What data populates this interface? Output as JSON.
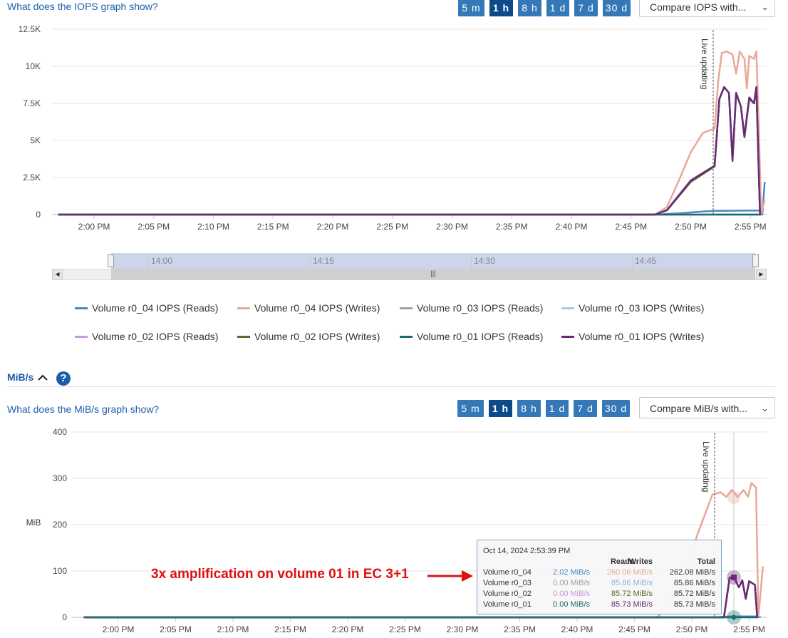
{
  "iops_section": {
    "help_link": "What does the IOPS graph show?",
    "range_buttons": [
      "5 m",
      "1 h",
      "8 h",
      "1 d",
      "7 d",
      "30 d"
    ],
    "active_range": "1 h",
    "compare_label": "Compare IOPS with...",
    "live_label": "Live updating",
    "navigator_ticks": [
      "14:00",
      "14:15",
      "14:30",
      "14:45"
    ],
    "legend": [
      {
        "name": "Volume r0_04 IOPS (Reads)",
        "color": "#4a88c0"
      },
      {
        "name": "Volume r0_04 IOPS (Writes)",
        "color": "#e8a898"
      },
      {
        "name": "Volume r0_03 IOPS (Reads)",
        "color": "#a0a0a0"
      },
      {
        "name": "Volume r0_03 IOPS (Writes)",
        "color": "#a8c8e8"
      },
      {
        "name": "Volume r0_02 IOPS (Reads)",
        "color": "#c89ad8"
      },
      {
        "name": "Volume r0_02 IOPS (Writes)",
        "color": "#556b2f"
      },
      {
        "name": "Volume r0_01 IOPS (Reads)",
        "color": "#1f6a6a"
      },
      {
        "name": "Volume r0_01 IOPS (Writes)",
        "color": "#6a2a78"
      }
    ]
  },
  "mibs_section": {
    "header_label": "MiB/s",
    "help_link": "What does the MiB/s graph show?",
    "range_buttons": [
      "5 m",
      "1 h",
      "8 h",
      "1 d",
      "7 d",
      "30 d"
    ],
    "active_range": "1 h",
    "compare_label": "Compare MiB/s with...",
    "live_label": "Live updating",
    "annotation": "3x amplification on volume 01 in EC 3+1",
    "annotation_color": "#e01010",
    "tooltip": {
      "timestamp": "Oct 14, 2024 2:53:39 PM",
      "headers": [
        "Reads",
        "Writes",
        "Total"
      ],
      "rows": [
        {
          "volume": "Volume r0_04",
          "reads": "2.02 MiB/s",
          "writes": "260.06 MiB/s",
          "total": "262.08 MiB/s",
          "reads_color": "#4a88c0",
          "writes_color": "#e8a898"
        },
        {
          "volume": "Volume r0_03",
          "reads": "0.00 MiB/s",
          "writes": "85.86 MiB/s",
          "total": "85.86 MiB/s",
          "reads_color": "#a0a0a0",
          "writes_color": "#8ab4dc"
        },
        {
          "volume": "Volume r0_02",
          "reads": "0.00 MiB/s",
          "writes": "85.72 MiB/s",
          "total": "85.72 MiB/s",
          "reads_color": "#c89ad8",
          "writes_color": "#556b2f"
        },
        {
          "volume": "Volume r0_01",
          "reads": "0.00 MiB/s",
          "writes": "85.73 MiB/s",
          "total": "85.73 MiB/s",
          "reads_color": "#1f6a6a",
          "writes_color": "#6a2a78"
        }
      ]
    }
  },
  "chart_data": [
    {
      "type": "line",
      "xlabel": "",
      "ylabel": "",
      "x_ticks": [
        "2:00 PM",
        "2:05 PM",
        "2:10 PM",
        "2:15 PM",
        "2:20 PM",
        "2:25 PM",
        "2:30 PM",
        "2:35 PM",
        "2:40 PM",
        "2:45 PM",
        "2:50 PM",
        "2:55 PM"
      ],
      "y_ticks": [
        "0",
        "2.5K",
        "5K",
        "7.5K",
        "10K",
        "12.5K"
      ],
      "ylim": [
        0,
        12500
      ],
      "series": [
        {
          "name": "Volume r0_04 IOPS (Reads)",
          "color": "#4a88c0",
          "points": [
            [
              -3,
              0
            ],
            [
              47,
              0
            ],
            [
              49,
              80
            ],
            [
              51,
              200
            ],
            [
              52,
              250
            ],
            [
              55,
              270
            ],
            [
              55.8,
              270
            ],
            [
              56,
              0
            ],
            [
              56.2,
              2200
            ]
          ]
        },
        {
          "name": "Volume r0_04 IOPS (Writes)",
          "color": "#e8a898",
          "points": [
            [
              -3,
              0
            ],
            [
              47,
              0
            ],
            [
              48,
              500
            ],
            [
              49,
              2300
            ],
            [
              50,
              4200
            ],
            [
              51,
              5500
            ],
            [
              52,
              5800
            ],
            [
              52.3,
              9000
            ],
            [
              52.6,
              10900
            ],
            [
              53,
              11000
            ],
            [
              53.5,
              10800
            ],
            [
              53.8,
              9500
            ],
            [
              54.1,
              11000
            ],
            [
              54.5,
              10500
            ],
            [
              54.7,
              8500
            ],
            [
              54.9,
              10700
            ],
            [
              55.3,
              10500
            ],
            [
              55.5,
              11000
            ],
            [
              55.7,
              6000
            ],
            [
              55.9,
              0
            ],
            [
              56.2,
              1000
            ]
          ]
        },
        {
          "name": "Volume r0_03 IOPS (Reads)",
          "color": "#a0a0a0",
          "points": [
            [
              -3,
              0
            ],
            [
              55.9,
              0
            ]
          ]
        },
        {
          "name": "Volume r0_03 IOPS (Writes)",
          "color": "#a8c8e8",
          "points": [
            [
              -3,
              0
            ],
            [
              47,
              0
            ],
            [
              48,
              300
            ],
            [
              50,
              2300
            ],
            [
              52,
              3300
            ],
            [
              52.4,
              7800
            ],
            [
              52.8,
              8600
            ],
            [
              53.2,
              8200
            ],
            [
              53.5,
              3700
            ],
            [
              53.8,
              8200
            ],
            [
              54.2,
              7300
            ],
            [
              54.5,
              5300
            ],
            [
              54.9,
              7900
            ],
            [
              55.3,
              7500
            ],
            [
              55.5,
              8600
            ],
            [
              55.8,
              0
            ]
          ]
        },
        {
          "name": "Volume r0_02 IOPS (Reads)",
          "color": "#c89ad8",
          "points": [
            [
              -3,
              0
            ],
            [
              55.9,
              0
            ]
          ]
        },
        {
          "name": "Volume r0_02 IOPS (Writes)",
          "color": "#556b2f",
          "points": [
            [
              -3,
              0
            ],
            [
              47,
              0
            ],
            [
              48,
              280
            ],
            [
              50,
              2200
            ],
            [
              52,
              3250
            ],
            [
              52.4,
              7800
            ],
            [
              52.8,
              8600
            ],
            [
              53.2,
              8200
            ],
            [
              53.5,
              3600
            ],
            [
              53.8,
              8200
            ],
            [
              54.2,
              7300
            ],
            [
              54.5,
              5200
            ],
            [
              54.9,
              7800
            ],
            [
              55.3,
              7500
            ],
            [
              55.5,
              8600
            ],
            [
              55.8,
              0
            ]
          ]
        },
        {
          "name": "Volume r0_01 IOPS (Reads)",
          "color": "#1f6a6a",
          "points": [
            [
              -3,
              0
            ],
            [
              55.9,
              0
            ]
          ]
        },
        {
          "name": "Volume r0_01 IOPS (Writes)",
          "color": "#6a2a78",
          "points": [
            [
              -3,
              0
            ],
            [
              47,
              0
            ],
            [
              48,
              300
            ],
            [
              50,
              2300
            ],
            [
              52,
              3300
            ],
            [
              52.4,
              7800
            ],
            [
              52.8,
              8600
            ],
            [
              53.2,
              8200
            ],
            [
              53.5,
              3700
            ],
            [
              53.8,
              8200
            ],
            [
              54.2,
              7300
            ],
            [
              54.5,
              5300
            ],
            [
              54.9,
              7900
            ],
            [
              55.3,
              7500
            ],
            [
              55.5,
              8600
            ],
            [
              55.8,
              0
            ]
          ]
        }
      ]
    },
    {
      "type": "line",
      "xlabel": "",
      "ylabel": "MiB",
      "x_ticks": [
        "2:00 PM",
        "2:05 PM",
        "2:10 PM",
        "2:15 PM",
        "2:20 PM",
        "2:25 PM",
        "2:30 PM",
        "2:35 PM",
        "2:40 PM",
        "2:45 PM",
        "2:50 PM",
        "2:55 PM"
      ],
      "y_ticks": [
        "0",
        "100",
        "200",
        "300",
        "400"
      ],
      "ylim": [
        0,
        400
      ],
      "series": [
        {
          "name": "Volume r0_04 MiB/s (Reads)",
          "color": "#4a88c0",
          "points": [
            [
              -3,
              0
            ],
            [
              52,
              0
            ],
            [
              53.3,
              2
            ],
            [
              55.8,
              2
            ],
            [
              56,
              0
            ]
          ]
        },
        {
          "name": "Volume r0_04 MiB/s (Writes)",
          "color": "#e8a898",
          "points": [
            [
              -3,
              0
            ],
            [
              47,
              0
            ],
            [
              49,
              60
            ],
            [
              50.5,
              180
            ],
            [
              51.8,
              265
            ],
            [
              52.5,
              270
            ],
            [
              53,
              260
            ],
            [
              53.5,
              275
            ],
            [
              54,
              260
            ],
            [
              54.5,
              275
            ],
            [
              54.9,
              260
            ],
            [
              55.2,
              290
            ],
            [
              55.6,
              280
            ],
            [
              55.8,
              0
            ],
            [
              56.2,
              110
            ]
          ]
        },
        {
          "name": "Volume r0_03 MiB/s (Writes)",
          "color": "#8ab4dc",
          "points": [
            [
              -3,
              0
            ],
            [
              52.8,
              0
            ],
            [
              53.3,
              86
            ],
            [
              53.7,
              85
            ],
            [
              54.1,
              65
            ],
            [
              54.4,
              80
            ],
            [
              54.7,
              40
            ],
            [
              55,
              78
            ],
            [
              55.5,
              70
            ],
            [
              55.7,
              0
            ]
          ]
        },
        {
          "name": "Volume r0_02 MiB/s (Writes)",
          "color": "#556b2f",
          "points": [
            [
              -3,
              0
            ],
            [
              52.8,
              0
            ],
            [
              53.3,
              86
            ],
            [
              53.7,
              85
            ],
            [
              54.1,
              65
            ],
            [
              54.4,
              80
            ],
            [
              54.7,
              40
            ],
            [
              55,
              78
            ],
            [
              55.5,
              70
            ],
            [
              55.7,
              0
            ]
          ]
        },
        {
          "name": "Volume r0_01 MiB/s (Writes)",
          "color": "#6a2a78",
          "points": [
            [
              -3,
              0
            ],
            [
              52.8,
              0
            ],
            [
              53.3,
              86
            ],
            [
              53.7,
              85
            ],
            [
              54.1,
              65
            ],
            [
              54.4,
              80
            ],
            [
              54.7,
              40
            ],
            [
              55,
              78
            ],
            [
              55.5,
              70
            ],
            [
              55.7,
              0
            ]
          ]
        },
        {
          "name": "Volume r0_01 MiB/s (Reads)",
          "color": "#1f6a6a",
          "points": [
            [
              -3,
              0
            ],
            [
              55.8,
              0
            ]
          ]
        }
      ]
    }
  ]
}
